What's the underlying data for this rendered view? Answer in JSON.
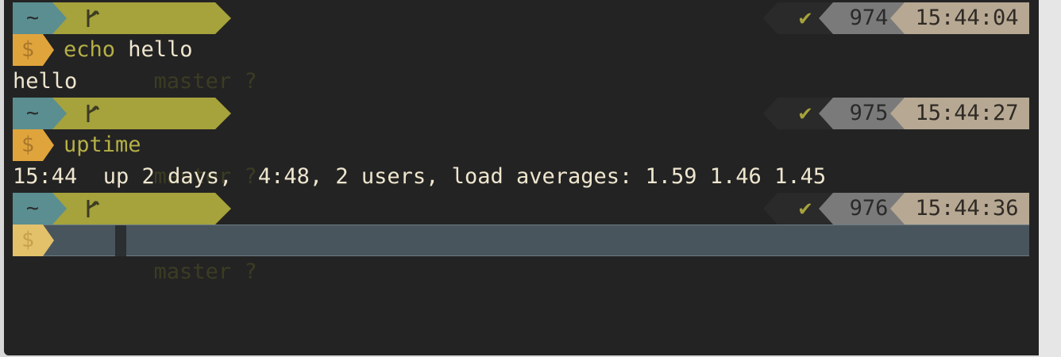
{
  "prompts": [
    {
      "dir": "~",
      "branch": "master ?",
      "status": "✔",
      "history": "974",
      "time": "15:44:04",
      "cmd_keyword": "echo",
      "cmd_args": " hello",
      "output": "hello"
    },
    {
      "dir": "~",
      "branch": "master ?",
      "status": "✔",
      "history": "975",
      "time": "15:44:27",
      "cmd_keyword": "uptime",
      "cmd_args": "",
      "output": "15:44  up 2 days,  4:48, 2 users, load averages: 1.59 1.46 1.45"
    },
    {
      "dir": "~",
      "branch": "master ?",
      "status": "✔",
      "history": "976",
      "time": "15:44:36"
    }
  ],
  "prompt_symbol": "$",
  "icons": {
    "branch": "git-branch-icon",
    "status": "checkmark-icon"
  },
  "colors": {
    "background": "#232323",
    "dir_segment": "#5a8e91",
    "branch_segment": "#a6a23c",
    "history_segment": "#7a7a7a",
    "time_segment": "#b6a893",
    "dollar_segment": "#e0a43c",
    "active_line": "#49555c"
  }
}
